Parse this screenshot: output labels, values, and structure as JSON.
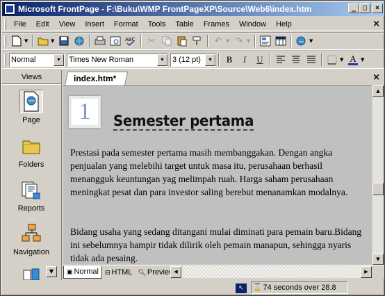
{
  "window": {
    "title": "Microsoft FrontPage - F:\\Buku\\WMP FrontPageXP\\Source\\Web6\\index.htm",
    "min": "_",
    "max": "□",
    "close": "×"
  },
  "menu": {
    "items": [
      {
        "label": "File"
      },
      {
        "label": "Edit"
      },
      {
        "label": "View"
      },
      {
        "label": "Insert"
      },
      {
        "label": "Format"
      },
      {
        "label": "Tools"
      },
      {
        "label": "Table"
      },
      {
        "label": "Frames"
      },
      {
        "label": "Window"
      },
      {
        "label": "Help"
      }
    ],
    "close": "×"
  },
  "format_toolbar": {
    "style": "Normal",
    "font": "Times New Roman",
    "size": "3  (12 pt)",
    "bold": "B",
    "italic": "I",
    "underline": "U",
    "font_color": "A"
  },
  "views": {
    "header": "Views",
    "items": [
      {
        "label": "Page",
        "icon": "page-icon"
      },
      {
        "label": "Folders",
        "icon": "folder-icon"
      },
      {
        "label": "Reports",
        "icon": "reports-icon"
      },
      {
        "label": "Navigation",
        "icon": "navigation-icon"
      }
    ]
  },
  "document": {
    "tab_label": "index.htm*",
    "close": "×",
    "number": "1",
    "heading": "Semester pertama",
    "paragraph1": "Prestasi pada semester pertama masih membanggakan. Dengan angka penjualan yang melebihi target untuk masa itu, perusahaan berhasil menangguk keuntungan yag melimpah ruah. Harga saham  perusahaan meningkat pesat dan para investor saling berebut menanamkan modalnya.",
    "paragraph2": "Bidang usaha yang sedang ditangani mulai diminati para pemain baru.Bidang ini sebelumnya hampir tidak dilirik oleh pemain manapun, sehingga nyaris tidak ada pesaing."
  },
  "modes": {
    "normal": "Normal",
    "html": "HTML",
    "preview": "Preview"
  },
  "status": {
    "time": "74 seconds over 28.8"
  },
  "colors": {
    "title_start": "#0a246a",
    "title_end": "#a6caf0",
    "chrome": "#d4d0c8",
    "page_bg": "#c0c0c0",
    "number_color": "#7d97c6"
  }
}
